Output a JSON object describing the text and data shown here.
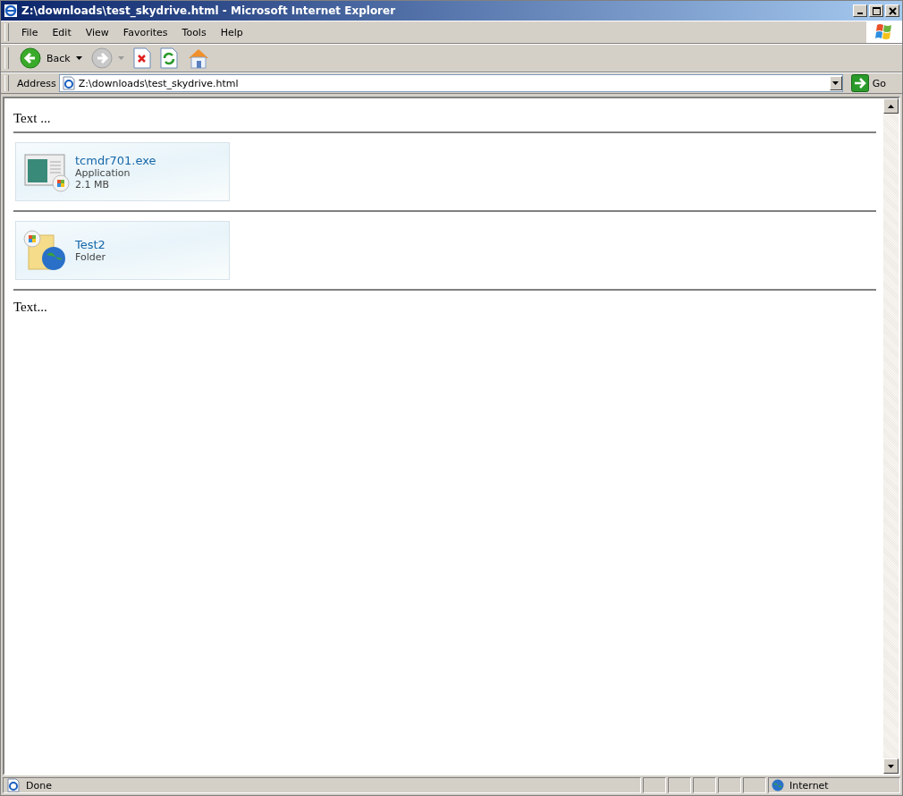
{
  "window": {
    "title": "Z:\\downloads\\test_skydrive.html - Microsoft Internet Explorer"
  },
  "menu": [
    "File",
    "Edit",
    "View",
    "Favorites",
    "Tools",
    "Help"
  ],
  "toolbar": {
    "back_label": "Back"
  },
  "address": {
    "label": "Address",
    "value": "Z:\\downloads\\test_skydrive.html",
    "go_label": "Go"
  },
  "content": {
    "intro": "Text ...",
    "items": [
      {
        "kind": "application",
        "name": "tcmdr701.exe",
        "type": "Application",
        "size": "2.1 MB"
      },
      {
        "kind": "folder",
        "name": "Test2",
        "type": "Folder"
      }
    ],
    "outro": "Text..."
  },
  "status_bar": {
    "status": "Done",
    "zone": "Internet"
  }
}
